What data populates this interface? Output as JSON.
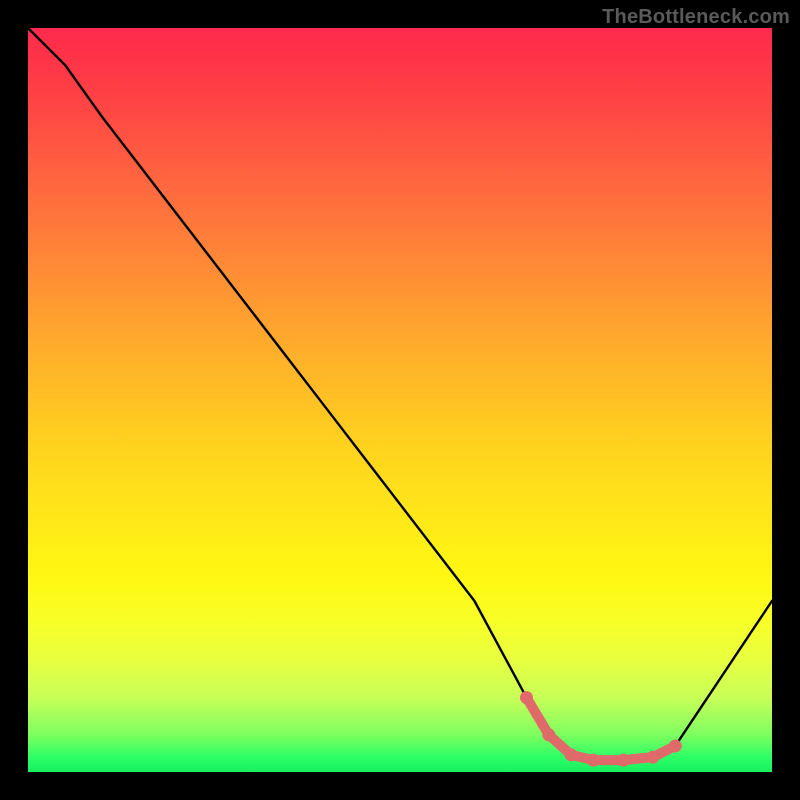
{
  "watermark": "TheBottleneck.com",
  "chart_data": {
    "type": "line",
    "title": "",
    "xlabel": "",
    "ylabel": "",
    "xlim": [
      0,
      100
    ],
    "ylim": [
      0,
      100
    ],
    "series": [
      {
        "name": "curve",
        "x": [
          0,
          5,
          10,
          20,
          30,
          40,
          50,
          60,
          67,
          70,
          73,
          76,
          80,
          84,
          87,
          100
        ],
        "y": [
          100,
          95,
          88,
          75,
          62,
          49,
          36,
          23,
          10,
          5,
          2.3,
          1.6,
          1.6,
          2,
          3.5,
          23
        ]
      },
      {
        "name": "marked-region",
        "x": [
          67,
          70,
          73,
          76,
          80,
          84,
          87
        ],
        "y": [
          10,
          5,
          2.3,
          1.6,
          1.6,
          2,
          3.5
        ]
      }
    ],
    "gradient_background": {
      "top_color": "#ff2a4d",
      "mid_color": "#ffe818",
      "bottom_color": "#18f060"
    },
    "marker_color": "#e06a6a",
    "curve_color": "#000000"
  }
}
